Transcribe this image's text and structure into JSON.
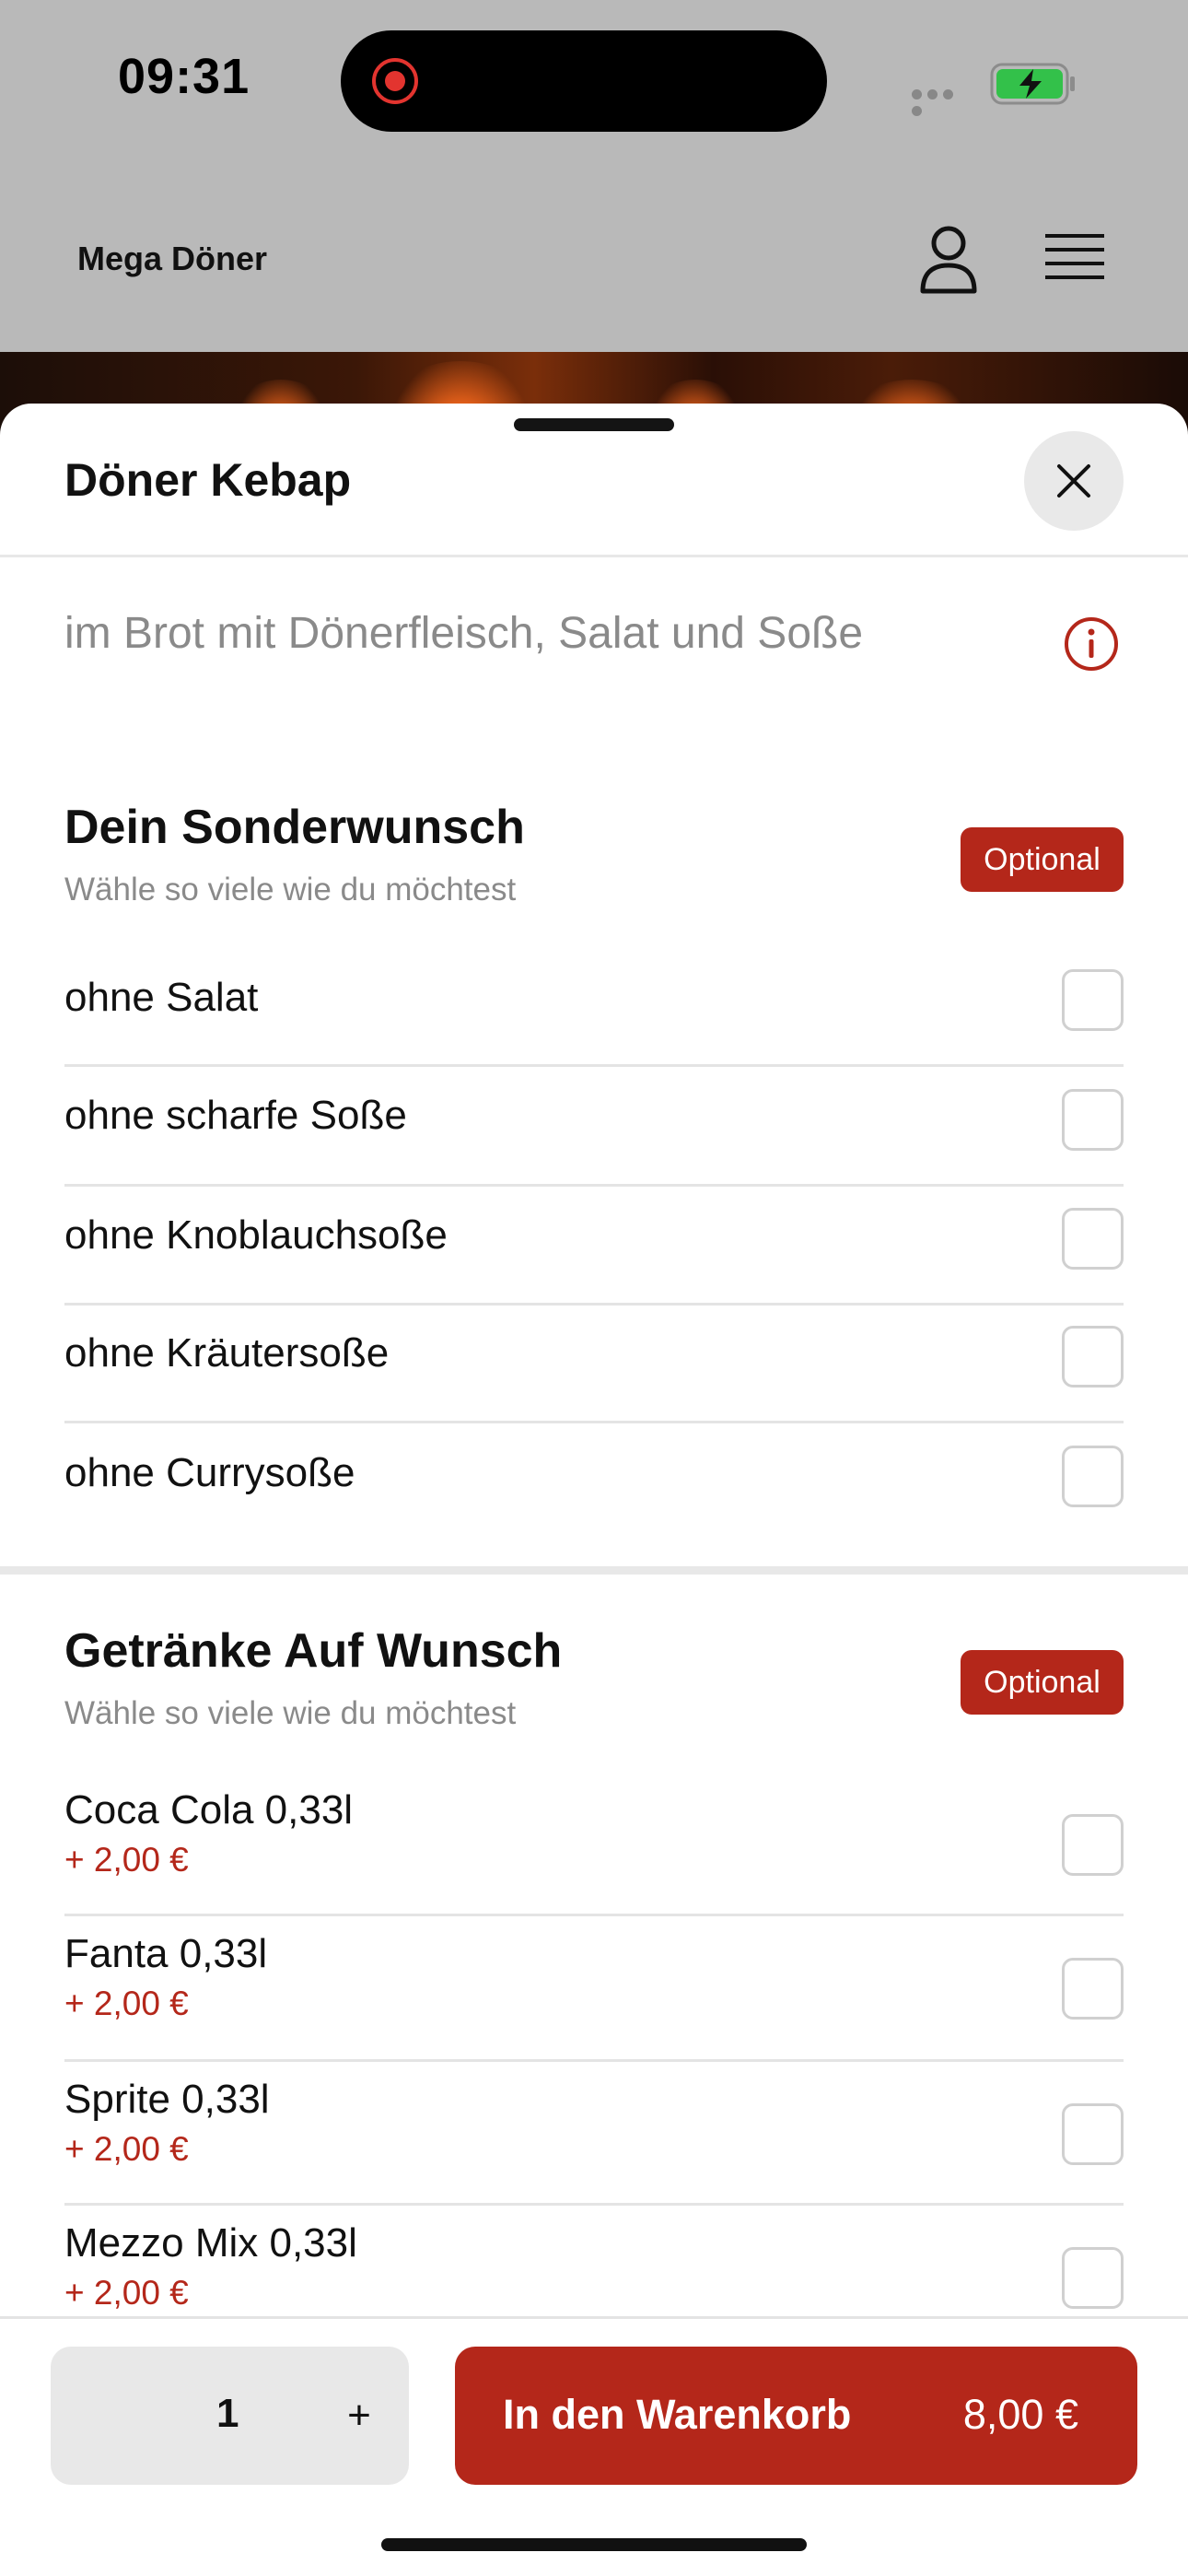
{
  "status_bar": {
    "time": "09:31"
  },
  "header": {
    "brand": "Mega Döner",
    "icons": [
      "user-icon",
      "menu-icon"
    ]
  },
  "sheet": {
    "title": "Döner Kebap",
    "description": "im Brot mit Dönerfleisch, Salat und Soße",
    "close_icon": "close-icon",
    "info_icon": "info-icon"
  },
  "sections": [
    {
      "title": "Dein Sonderwunsch",
      "subtitle": "Wähle so viele wie du möchtest",
      "badge": "Optional",
      "options": [
        {
          "label": "ohne Salat",
          "checked": false
        },
        {
          "label": "ohne scharfe Soße",
          "checked": false
        },
        {
          "label": "ohne Knoblauchsoße",
          "checked": false
        },
        {
          "label": "ohne Kräutersoße",
          "checked": false
        },
        {
          "label": "ohne Currysoße",
          "checked": false
        }
      ]
    },
    {
      "title": "Getränke Auf Wunsch",
      "subtitle": "Wähle so viele wie du möchtest",
      "badge": "Optional",
      "options": [
        {
          "label": "Coca Cola 0,33l",
          "price": "+ 2,00 €",
          "checked": false
        },
        {
          "label": "Fanta 0,33l",
          "price": "+ 2,00 €",
          "checked": false
        },
        {
          "label": "Sprite 0,33l",
          "price": "+ 2,00 €",
          "checked": false
        },
        {
          "label": "Mezzo Mix 0,33l",
          "price": "+ 2,00 €",
          "checked": false
        }
      ]
    }
  ],
  "footer": {
    "quantity": "1",
    "plus": "+",
    "cart_label": "In den Warenkorb",
    "cart_price": "8,00 €"
  },
  "colors": {
    "accent": "#b4271a",
    "muted_text": "#8a8a8a",
    "header_bg": "#b9b9b9"
  }
}
